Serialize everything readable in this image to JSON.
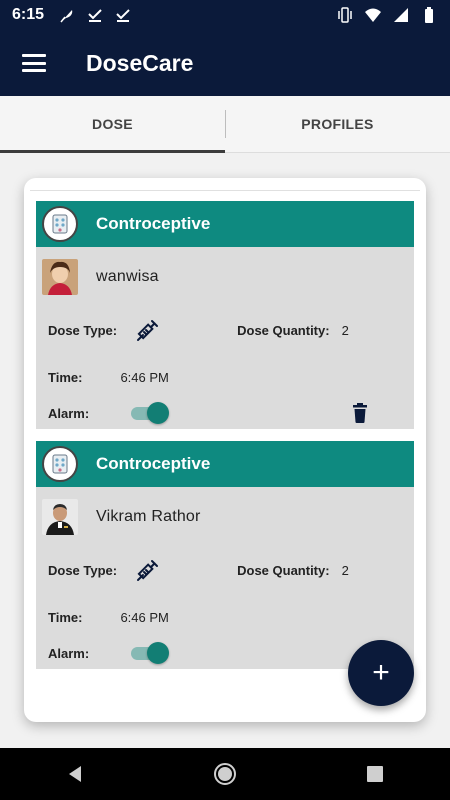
{
  "status_bar": {
    "time": "6:15",
    "left_icons": [
      "feather-icon",
      "check-icon",
      "check-icon"
    ],
    "right_icons": [
      "vibrate-icon",
      "wifi-icon",
      "signal-icon",
      "battery-icon"
    ]
  },
  "app_bar": {
    "title": "DoseCare",
    "menu_icon": "hamburger-menu-icon"
  },
  "tabs": [
    {
      "label": "DOSE",
      "active": true
    },
    {
      "label": "PROFILES",
      "active": false
    }
  ],
  "doses": [
    {
      "medicine": "Controceptive",
      "profile_name": "wanwisa",
      "dose_type_label": "Dose Type:",
      "dose_type_icon": "syringe-icon",
      "dose_quantity_label": "Dose Quantity:",
      "dose_quantity": "2",
      "time_label": "Time:",
      "time": "6:46 PM",
      "alarm_label": "Alarm:",
      "alarm_on": true
    },
    {
      "medicine": "Controceptive",
      "profile_name": "Vikram Rathor",
      "dose_type_label": "Dose Type:",
      "dose_type_icon": "syringe-icon",
      "dose_quantity_label": "Dose Quantity:",
      "dose_quantity": "2",
      "time_label": "Time:",
      "time": "6:46 PM",
      "alarm_label": "Alarm:",
      "alarm_on": true
    }
  ],
  "fab": {
    "label": "+"
  },
  "colors": {
    "primary": "#0b1a3a",
    "teal": "#0e8a80",
    "card_bg": "#dcdcdc"
  }
}
